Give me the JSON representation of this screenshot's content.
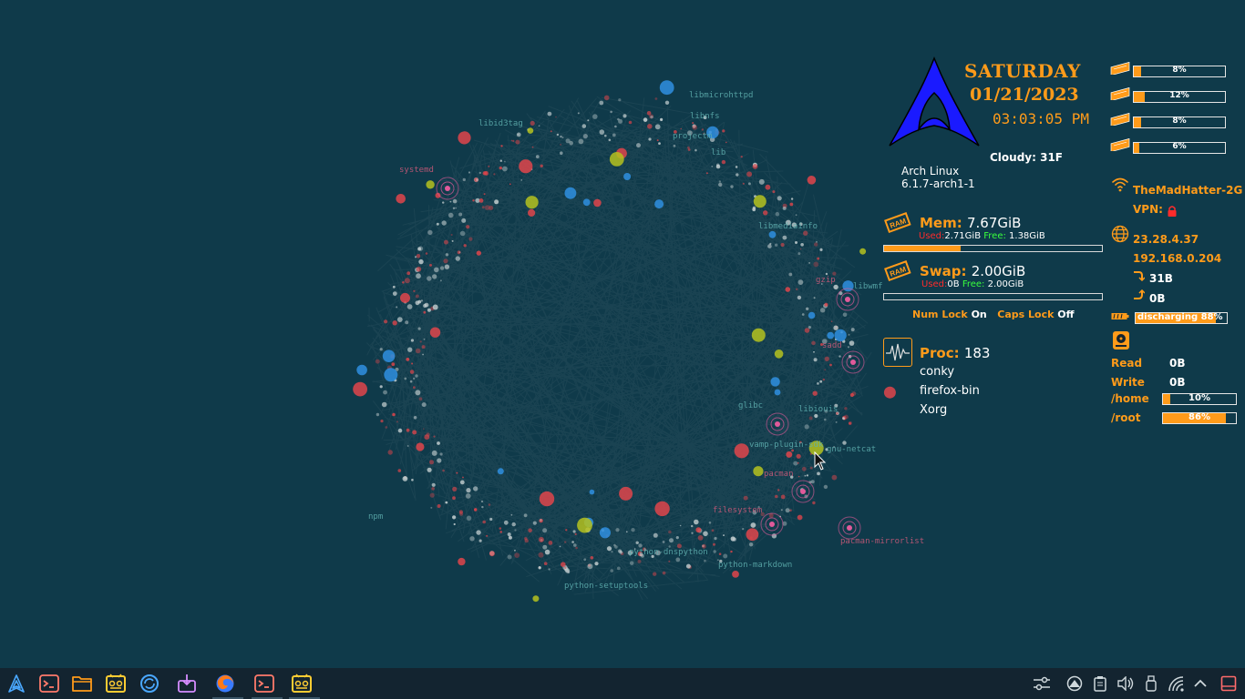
{
  "desktop": {
    "graph_labels": [
      "libmicrohttpd",
      "libnfs",
      "projectm",
      "libid3tag",
      "systemd",
      "libmediainfo",
      "libwmf",
      "glibc",
      "libiouis",
      "vamp-plugin-sdk",
      "gnu-netcat",
      "pacman",
      "filesystem",
      "npm",
      "python-dnspython",
      "python-markdown",
      "python-setuptools",
      "pacman-mirrorlist",
      "sadd",
      "gzip",
      "lib"
    ]
  },
  "conky": {
    "day": "SATURDAY",
    "date": "01/21/2023",
    "time": "03:03:05 PM",
    "weather": "Cloudy: 31F",
    "os_name": "Arch Linux",
    "os_kernel": "6.1.7-arch1-1",
    "mem": {
      "label": "Mem:",
      "total": "7.67GiB",
      "used_label": "Used:",
      "used": "2.71GiB",
      "free_label": "Free:",
      "free": "1.38GiB",
      "fraction": 0.35,
      "icon": "ram-icon"
    },
    "swap": {
      "label": "Swap:",
      "total": "2.00GiB",
      "used_label": "Used:",
      "used": "0B",
      "free_label": "Free:",
      "free": "2.00GiB",
      "fraction": 0.0,
      "icon": "ram-icon"
    },
    "locks": {
      "num_label": "Num Lock",
      "num_state": "On",
      "caps_label": "Caps Lock",
      "caps_state": "Off"
    },
    "proc": {
      "label": "Proc:",
      "count": "183",
      "top": [
        "conky",
        "firefox-bin",
        "Xorg"
      ],
      "icon": "activity-icon"
    },
    "cpu": [
      {
        "text": "8%",
        "value": 0.08
      },
      {
        "text": "12%",
        "value": 0.12
      },
      {
        "text": "8%",
        "value": 0.08
      },
      {
        "text": "6%",
        "value": 0.06
      }
    ],
    "network": {
      "ssid": "TheMadHatter-2G",
      "vpn_label": "VPN:",
      "public_ip": "23.28.4.37",
      "local_ip": "192.168.0.204",
      "upload": "31B",
      "download": "0B",
      "wifi_icon": "wifi-icon",
      "globe_icon": "globe-icon",
      "lock_icon": "lock-icon"
    },
    "battery": {
      "text": "discharging 88%",
      "value": 0.88,
      "icon": "battery-icon"
    },
    "disk": {
      "icon": "hard-drive-icon",
      "read_label": "Read",
      "read": "0B",
      "write_label": "Write",
      "write": "0B",
      "home_label": "/home",
      "home_text": "10%",
      "home_value": 0.1,
      "root_label": "/root",
      "root_text": "86%",
      "root_value": 0.86
    }
  },
  "taskbar": {
    "apps": [
      {
        "name": "launcher",
        "icon": "arch-launcher-icon"
      },
      {
        "name": "terminal",
        "icon": "terminal-icon"
      },
      {
        "name": "files",
        "icon": "folder-icon"
      },
      {
        "name": "monitor",
        "icon": "system-monitor-icon"
      },
      {
        "name": "update",
        "icon": "refresh-icon"
      },
      {
        "name": "installer",
        "icon": "package-installer-icon"
      },
      {
        "name": "firefox",
        "icon": "firefox-icon"
      },
      {
        "name": "terminal-2",
        "icon": "terminal-icon"
      },
      {
        "name": "monitor-2",
        "icon": "system-monitor-icon"
      }
    ],
    "tray": [
      "settings-icon",
      "network-icon",
      "clipboard-icon",
      "volume-icon",
      "usb-icon",
      "wifi-icon",
      "chevron-up-icon",
      "show-desktop-icon"
    ],
    "colors": {
      "background": "#132430",
      "accent": "#ff9b1a"
    }
  }
}
